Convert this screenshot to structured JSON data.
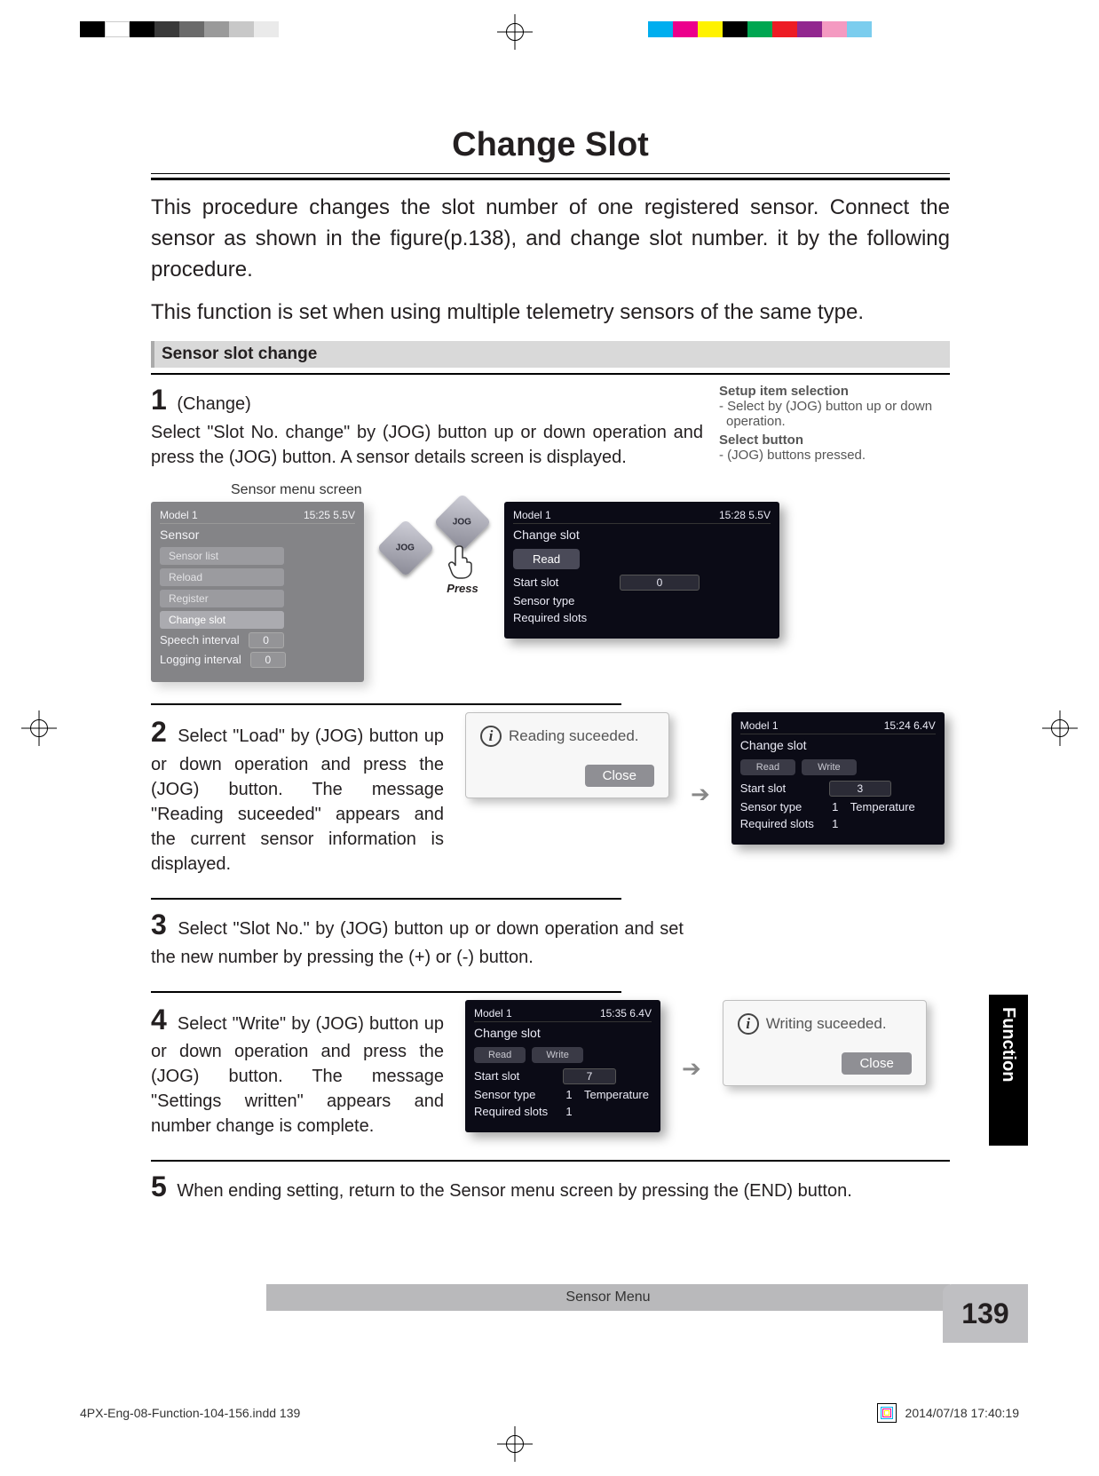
{
  "page": {
    "title": "Change Slot",
    "intro1": "This procedure changes the slot number of one registered sensor. Connect the sensor as shown in the figure(p.138), and change slot number. it by the following procedure.",
    "intro2": "This function is set when using multiple telemetry sensors of the same type.",
    "section_heading": "Sensor slot change",
    "footer_label": "Sensor Menu",
    "page_number": "139",
    "side_tab": "Function",
    "indd_ref": "4PX-Eng-08-Function-104-156.indd   139",
    "indd_date": "2014/07/18   17:40:19"
  },
  "notes": {
    "h1": "Setup item selection",
    "v1": "- Select by (JOG) button up or down operation.",
    "h2": "Select button",
    "v2": "- (JOG) buttons pressed."
  },
  "steps": {
    "s1_num": "1",
    "s1_label": "(Change)",
    "s1_text": "Select \"Slot No. change\" by (JOG) button up or down operation and press the (JOG) button. A sensor details screen is displayed.",
    "s2_num": "2",
    "s2_text": "Select \"Load\" by (JOG) button up or down operation and press the (JOG) button. The message \"Reading suceeded\" appears and the current sensor information is displayed.",
    "s3_num": "3",
    "s3_text": "Select \"Slot No.\" by (JOG) button up or down operation and set the new number by pressing the (+) or (-) button.",
    "s4_num": "4",
    "s4_text": "Select \"Write\" by (JOG) button up or down operation and press the (JOG) button. The message \"Settings written\" appears and number change is complete.",
    "s5_num": "5",
    "s5_text": "When ending setting, return to the Sensor menu screen by pressing the (END) button."
  },
  "fig1": {
    "caption": "Sensor menu screen",
    "jog_label": "JOG",
    "press_label": "Press",
    "faded_menu": {
      "model": "Model 1",
      "time": "15:25 5.5V",
      "heading": "Sensor",
      "items": [
        "Sensor list",
        "Reload",
        "Register",
        "Change slot",
        "Speech interval",
        "Logging interval"
      ],
      "val0": "0",
      "val1": "0"
    },
    "detail": {
      "model": "Model 1",
      "time": "15:28 5.5V",
      "heading": "Change slot",
      "read": "Read",
      "row1": "Start slot",
      "row1_val": "0",
      "row2": "Sensor type",
      "row3": "Required slots"
    }
  },
  "fig2": {
    "dialog_msg": "Reading suceeded.",
    "dialog_close": "Close",
    "detail": {
      "model": "Model 1",
      "time": "15:24 6.4V",
      "heading": "Change slot",
      "read": "Read",
      "write": "Write",
      "row1": "Start slot",
      "row1_val": "3",
      "row2": "Sensor type",
      "row2_idx": "1",
      "row2_val": "Temperature",
      "row3": "Required slots",
      "row3_val": "1"
    }
  },
  "fig4": {
    "detail": {
      "model": "Model 1",
      "time": "15:35 6.4V",
      "heading": "Change slot",
      "read": "Read",
      "write": "Write",
      "row1": "Start slot",
      "row1_val": "7",
      "row2": "Sensor type",
      "row2_idx": "1",
      "row2_val": "Temperature",
      "row3": "Required slots",
      "row3_val": "1"
    },
    "dialog_msg": "Writing suceeded.",
    "dialog_close": "Close"
  },
  "printer_bars": {
    "left": [
      "#000000",
      "#ffffff",
      "#000000",
      "#3a3a3a",
      "#6a6a6a",
      "#9a9a9a",
      "#c8c8c8",
      "#eaeaea",
      "#ffffff"
    ],
    "right": [
      "#ffffff",
      "#00aeef",
      "#ec008c",
      "#fff200",
      "#000000",
      "#00a651",
      "#ed1c24",
      "#92278f",
      "#f49ac1",
      "#7bcdee",
      "#ffffff"
    ]
  }
}
